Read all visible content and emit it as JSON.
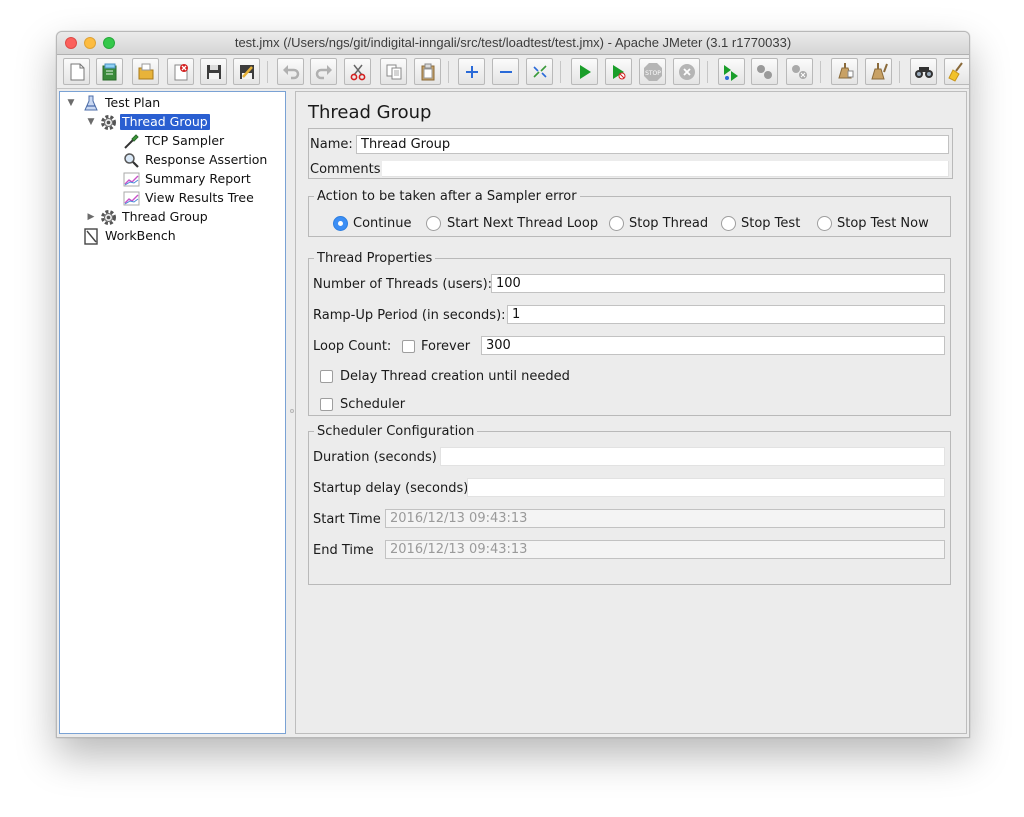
{
  "window": {
    "title": "test.jmx (/Users/ngs/git/indigital-inngali/src/test/loadtest/test.jmx) - Apache JMeter (3.1 r1770033)"
  },
  "toolbar": {
    "buttons": [
      "new-icon",
      "templates-icon",
      "open-icon",
      "close-file-icon",
      "save-icon",
      "save-as-icon",
      "undo-icon",
      "redo-icon",
      "cut-icon",
      "copy-icon",
      "paste-icon",
      "expand-icon",
      "collapse-icon",
      "toggle-icon",
      "start-icon",
      "start-no-pause-icon",
      "stop-icon",
      "shutdown-icon",
      "remote-start-icon",
      "remote-stop-icon",
      "remote-shutdown-icon",
      "clear-icon",
      "clear-all-icon",
      "search-icon",
      "reset-search-icon"
    ]
  },
  "tree": {
    "items": [
      {
        "label": "Test Plan",
        "icon": "test-plan-icon"
      },
      {
        "label": "Thread Group",
        "icon": "gear-icon",
        "selected": true
      },
      {
        "label": "TCP Sampler",
        "icon": "pipette-icon"
      },
      {
        "label": "Response Assertion",
        "icon": "magnifier-icon"
      },
      {
        "label": "Summary Report",
        "icon": "chart-icon"
      },
      {
        "label": "View Results Tree",
        "icon": "chart-icon"
      },
      {
        "label": "Thread Group",
        "icon": "gear-icon"
      },
      {
        "label": "WorkBench",
        "icon": "workbench-icon"
      }
    ]
  },
  "panel": {
    "title": "Thread Group",
    "name_label": "Name:",
    "name_value": "Thread Group",
    "comments_label": "Comments:",
    "comments_value": ""
  },
  "sampler_error": {
    "legend": "Action to be taken after a Sampler error",
    "options": [
      "Continue",
      "Start Next Thread Loop",
      "Stop Thread",
      "Stop Test",
      "Stop Test Now"
    ],
    "selected": "Continue"
  },
  "thread_props": {
    "legend": "Thread Properties",
    "threads_label": "Number of Threads (users):",
    "threads_value": "100",
    "rampup_label": "Ramp-Up Period (in seconds):",
    "rampup_value": "1",
    "loop_label": "Loop Count:",
    "forever_label": "Forever",
    "forever_checked": false,
    "loop_value": "300",
    "delay_label": "Delay Thread creation until needed",
    "delay_checked": false,
    "scheduler_label": "Scheduler",
    "scheduler_checked": false
  },
  "scheduler": {
    "legend": "Scheduler Configuration",
    "duration_label": "Duration (seconds)",
    "duration_value": "",
    "startup_label": "Startup delay (seconds)",
    "startup_value": "",
    "start_label": "Start Time",
    "start_value": "2016/12/13 09:43:13",
    "end_label": "End Time",
    "end_value": "2016/12/13 09:43:13"
  },
  "colors": {
    "selection": "#2a5fd1",
    "radio_on": "#3b8ef5",
    "start_green": "#1a9e2a",
    "cut_red": "#d32020"
  }
}
